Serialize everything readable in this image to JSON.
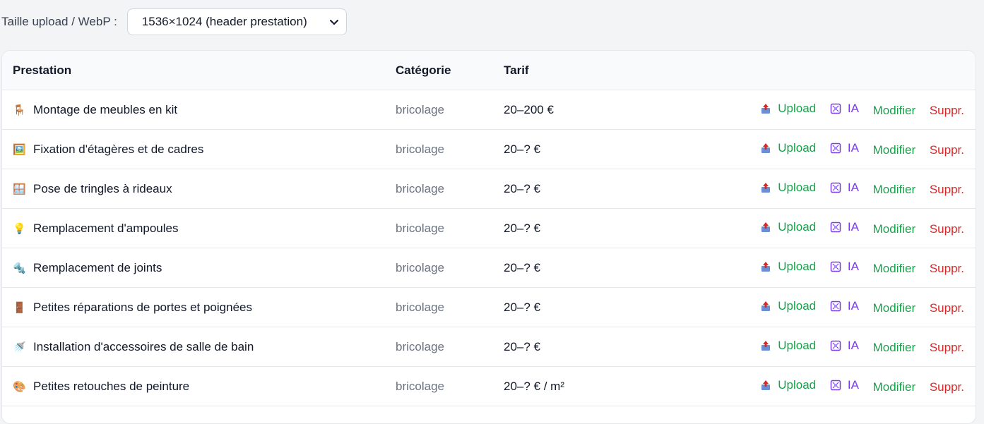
{
  "toolbar": {
    "label": "Taille upload / WebP :",
    "select_value": "1536×1024 (header prestation)"
  },
  "table": {
    "headers": {
      "prestation": "Prestation",
      "categorie": "Catégorie",
      "tarif": "Tarif"
    },
    "actions": {
      "upload": "Upload",
      "ia": "IA",
      "edit": "Modifier",
      "delete": "Suppr."
    },
    "rows": [
      {
        "emoji": "🪑",
        "name": "Montage de meubles en kit",
        "category": "bricolage",
        "tarif": "20–200 €"
      },
      {
        "emoji": "🖼️",
        "name": "Fixation d'étagères et de cadres",
        "category": "bricolage",
        "tarif": "20–? €"
      },
      {
        "emoji": "🪟",
        "name": "Pose de tringles à rideaux",
        "category": "bricolage",
        "tarif": "20–? €"
      },
      {
        "emoji": "💡",
        "name": "Remplacement d'ampoules",
        "category": "bricolage",
        "tarif": "20–? €"
      },
      {
        "emoji": "🔩",
        "name": "Remplacement de joints",
        "category": "bricolage",
        "tarif": "20–? €"
      },
      {
        "emoji": "🚪",
        "name": "Petites réparations de portes et poignées",
        "category": "bricolage",
        "tarif": "20–? €"
      },
      {
        "emoji": "🚿",
        "name": "Installation d'accessoires de salle de bain",
        "category": "bricolage",
        "tarif": "20–? €"
      },
      {
        "emoji": "🎨",
        "name": "Petites retouches de peinture",
        "category": "bricolage",
        "tarif": "20–? € / m²"
      }
    ]
  },
  "colors": {
    "upload": "#16a34a",
    "ia": "#7c3aed",
    "edit": "#16a34a",
    "delete": "#dc2626"
  }
}
